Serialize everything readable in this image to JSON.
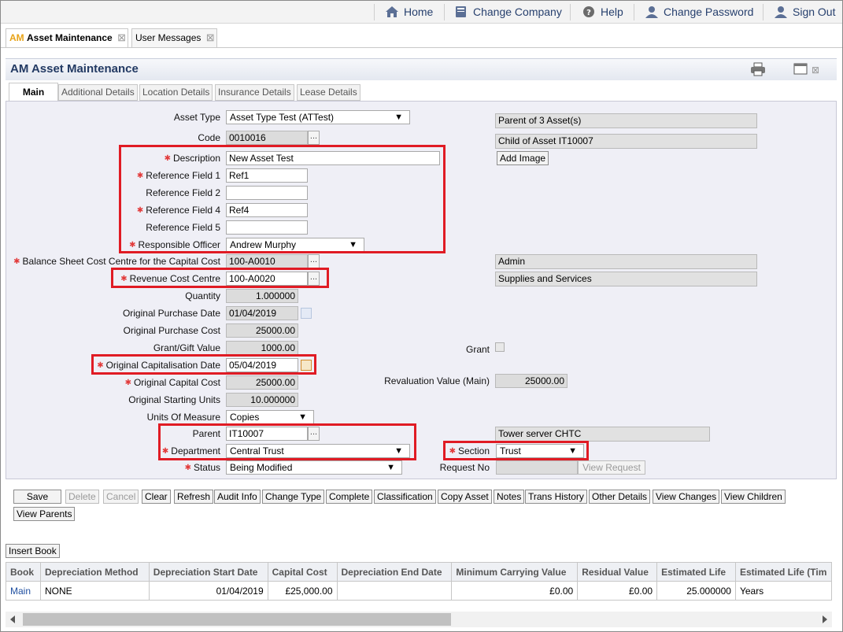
{
  "topnav": {
    "home": "Home",
    "change_company": "Change Company",
    "help": "Help",
    "change_password": "Change Password",
    "sign_out": "Sign Out"
  },
  "page_tabs": {
    "asset_prefix": "AM",
    "asset_label": "Asset Maintenance",
    "messages_label": "User Messages"
  },
  "title": "AM Asset Maintenance",
  "inner_tabs": [
    "Main",
    "Additional Details",
    "Location Details",
    "Insurance Details",
    "Lease Details"
  ],
  "form": {
    "asset_type": {
      "label": "Asset Type",
      "value": "Asset Type Test (ATTest)"
    },
    "code": {
      "label": "Code",
      "value": "0010016"
    },
    "description": {
      "label": "Description",
      "value": "New Asset Test"
    },
    "ref1": {
      "label": "Reference Field 1",
      "value": "Ref1"
    },
    "ref2": {
      "label": "Reference Field 2",
      "value": ""
    },
    "ref4": {
      "label": "Reference Field 4",
      "value": "Ref4"
    },
    "ref5": {
      "label": "Reference Field 5",
      "value": ""
    },
    "officer": {
      "label": "Responsible Officer",
      "value": "Andrew Murphy"
    },
    "bs_cost_centre": {
      "label": "Balance Sheet Cost Centre for the Capital Cost",
      "value": "100-A0010",
      "desc": "Admin"
    },
    "rev_cost_centre": {
      "label": "Revenue Cost Centre",
      "value": "100-A0020",
      "desc": "Supplies and Services"
    },
    "quantity": {
      "label": "Quantity",
      "value": "1.000000"
    },
    "purchase_date": {
      "label": "Original Purchase Date",
      "value": "01/04/2019"
    },
    "purchase_cost": {
      "label": "Original Purchase Cost",
      "value": "25000.00"
    },
    "grant_value": {
      "label": "Grant/Gift Value",
      "value": "1000.00"
    },
    "grant": {
      "label": "Grant"
    },
    "cap_date": {
      "label": "Original Capitalisation Date",
      "value": "05/04/2019"
    },
    "cap_cost": {
      "label": "Original Capital Cost",
      "value": "25000.00"
    },
    "reval": {
      "label": "Revaluation Value (Main)",
      "value": "25000.00"
    },
    "units": {
      "label": "Original Starting Units",
      "value": "10.000000"
    },
    "uom": {
      "label": "Units Of Measure",
      "value": "Copies"
    },
    "parent": {
      "label": "Parent",
      "value": "IT10007",
      "desc": "Tower server CHTC"
    },
    "department": {
      "label": "Department",
      "value": "Central Trust"
    },
    "section": {
      "label": "Section",
      "value": "Trust"
    },
    "status": {
      "label": "Status",
      "value": "Being Modified"
    },
    "request_no": {
      "label": "Request No",
      "value": ""
    },
    "view_request": "View Request",
    "parent_of": "Parent of 3 Asset(s)",
    "child_of": "Child of Asset IT10007",
    "add_image": "Add Image",
    "ellipsis": "..."
  },
  "buttons": {
    "save": "Save",
    "delete": "Delete",
    "cancel": "Cancel",
    "clear": "Clear",
    "refresh": "Refresh",
    "audit_info": "Audit Info",
    "change_type": "Change Type",
    "complete": "Complete",
    "classification": "Classification",
    "copy_asset": "Copy Asset",
    "notes": "Notes",
    "trans_history": "Trans History",
    "other_details": "Other Details",
    "view_changes": "View Changes",
    "view_children": "View Children",
    "view_parents": "View Parents"
  },
  "insert_book": "Insert Book",
  "book_grid": {
    "columns": [
      "Book",
      "Depreciation Method",
      "Depreciation Start Date",
      "Capital Cost",
      "Depreciation End Date",
      "Minimum Carrying Value",
      "Residual Value",
      "Estimated Life",
      "Estimated Life (Tim"
    ],
    "rows": [
      [
        "Main",
        "NONE",
        "01/04/2019",
        "£25,000.00",
        "",
        "£0.00",
        "£0.00",
        "25.000000",
        "Years"
      ]
    ]
  },
  "colors": {
    "highlight": "#e01b24",
    "required": "#e23b3b",
    "nav_text": "#27406e",
    "link": "#1f4fa0"
  }
}
